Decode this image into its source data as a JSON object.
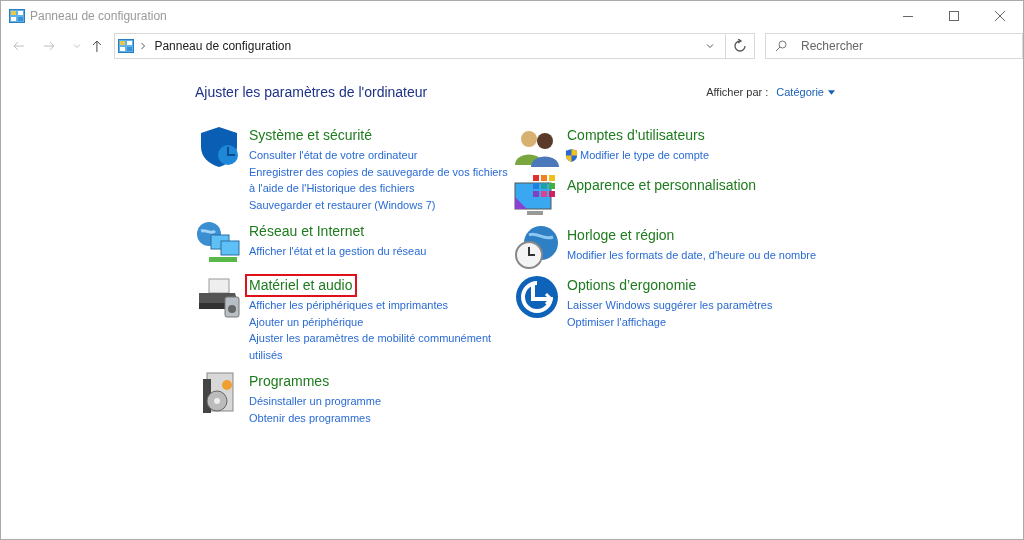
{
  "window": {
    "title": "Panneau de configuration"
  },
  "address_bar": {
    "path": "Panneau de configuration"
  },
  "search": {
    "placeholder": "Rechercher"
  },
  "heading": "Ajuster les paramètres de l'ordinateur",
  "view_by": {
    "label": "Afficher par :",
    "value": "Catégorie"
  },
  "columns": [
    {
      "categories": [
        {
          "kind": "shield",
          "title": "Système et sécurité",
          "highlighted": false,
          "links": [
            {
              "text": "Consulter l'état de votre ordinateur",
              "shield": false
            },
            {
              "text": "Enregistrer des copies de sauvegarde de vos fichiers à l'aide de l'Historique des fichiers",
              "shield": false
            },
            {
              "text": "Sauvegarder et restaurer (Windows 7)",
              "shield": false
            }
          ]
        },
        {
          "kind": "network",
          "title": "Réseau et Internet",
          "highlighted": false,
          "links": [
            {
              "text": "Afficher l'état et la gestion du réseau",
              "shield": false
            }
          ]
        },
        {
          "kind": "printer",
          "title": "Matériel et audio",
          "highlighted": true,
          "links": [
            {
              "text": "Afficher les périphériques et imprimantes",
              "shield": false
            },
            {
              "text": "Ajouter un périphérique",
              "shield": false
            },
            {
              "text": "Ajuster les paramètres de mobilité communément utilisés",
              "shield": false
            }
          ]
        },
        {
          "kind": "programs",
          "title": "Programmes",
          "highlighted": false,
          "links": [
            {
              "text": "Désinstaller un programme",
              "shield": false
            },
            {
              "text": "Obtenir des programmes",
              "shield": false
            }
          ]
        }
      ]
    },
    {
      "categories": [
        {
          "kind": "users",
          "title": "Comptes d’utilisateurs",
          "highlighted": false,
          "links": [
            {
              "text": "Modifier le type de compte",
              "shield": true
            }
          ]
        },
        {
          "kind": "appearance",
          "title": "Apparence et personnalisation",
          "highlighted": false
        },
        {
          "kind": "clock",
          "title": "Horloge et région",
          "highlighted": false,
          "links": [
            {
              "text": "Modifier les formats de date, d'heure ou de nombre",
              "shield": false
            }
          ]
        },
        {
          "kind": "ergonomics",
          "title": "Options d’ergonomie",
          "highlighted": false,
          "links": [
            {
              "text": "Laisser Windows suggérer les paramètres",
              "shield": false
            },
            {
              "text": "Optimiser l'affichage",
              "shield": false
            }
          ]
        }
      ]
    }
  ]
}
